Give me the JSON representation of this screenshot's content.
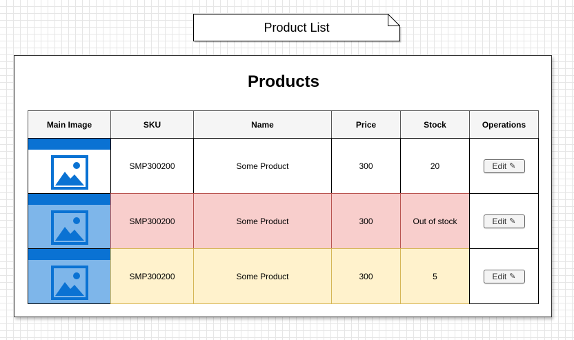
{
  "note": {
    "title": "Product List"
  },
  "panel": {
    "title": "Products"
  },
  "table": {
    "columns": [
      "Main Image",
      "SKU",
      "Name",
      "Price",
      "Stock",
      "Operations"
    ],
    "rows": [
      {
        "sku": "SMP300200",
        "name": "Some Product",
        "price": "300",
        "stock": "20",
        "edit_label": "Edit",
        "edit_icon": "✎",
        "status": "normal"
      },
      {
        "sku": "SMP300200",
        "name": "Some Product",
        "price": "300",
        "stock": "Out of stock",
        "edit_label": "Edit",
        "edit_icon": "✎",
        "status": "out-of-stock"
      },
      {
        "sku": "SMP300200",
        "name": "Some Product",
        "price": "300",
        "stock": "5",
        "edit_label": "Edit",
        "edit_icon": "✎",
        "status": "low-stock"
      }
    ]
  },
  "colors": {
    "out_of_stock_fill": "#f8cecc",
    "out_of_stock_stroke": "#b85450",
    "low_stock_fill": "#fff2cc",
    "low_stock_stroke": "#d6b656",
    "image_placeholder_fill": "#7eb6ea",
    "image_placeholder_accent": "#0a72d3"
  },
  "icons": {
    "image_placeholder": "image-placeholder-icon",
    "edit": "pencil-icon"
  }
}
